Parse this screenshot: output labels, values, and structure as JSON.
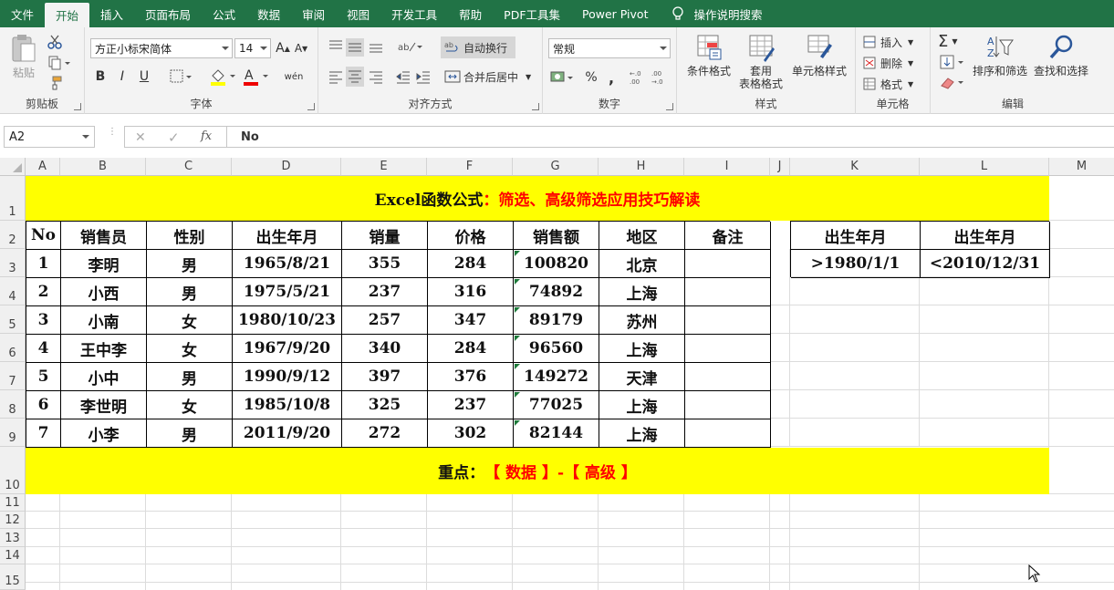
{
  "tabs": [
    "文件",
    "开始",
    "插入",
    "页面布局",
    "公式",
    "数据",
    "审阅",
    "视图",
    "开发工具",
    "帮助",
    "PDF工具集",
    "Power Pivot"
  ],
  "active_tab": "开始",
  "tell_me": "操作说明搜索",
  "ribbon": {
    "clipboard": {
      "label": "剪贴板",
      "paste": "粘贴"
    },
    "font": {
      "label": "字体",
      "name": "方正小标宋简体",
      "size": "14",
      "bold": "B",
      "italic": "I",
      "underline": "U",
      "grow": "A",
      "shrink": "A",
      "wen": "wén"
    },
    "align": {
      "label": "对齐方式",
      "wrap": "自动换行",
      "merge": "合并后居中"
    },
    "number": {
      "label": "数字",
      "format": "常规",
      "percent": "%",
      "comma": ","
    },
    "styles": {
      "label": "样式",
      "cond": "条件格式",
      "table_1": "套用",
      "table_2": "表格格式",
      "cell": "单元格样式"
    },
    "cells": {
      "label": "单元格",
      "insert": "插入",
      "delete": "删除",
      "format": "格式"
    },
    "edit": {
      "label": "编辑",
      "sum": "Σ",
      "sort": "排序和筛选",
      "find": "查找和选择"
    }
  },
  "formula_bar": {
    "name_box": "A2",
    "fx": "fx",
    "value": "No"
  },
  "columns": [
    "A",
    "B",
    "C",
    "D",
    "E",
    "F",
    "G",
    "H",
    "I",
    "J",
    "K",
    "L",
    "M"
  ],
  "rows": [
    "1",
    "2",
    "3",
    "4",
    "5",
    "6",
    "7",
    "8",
    "9",
    "10",
    "11",
    "12",
    "13",
    "14",
    "15"
  ],
  "sheet": {
    "title_black": "Excel函数公式",
    "title_red": "：筛选、高级筛选应用技巧解读",
    "headers": [
      "No",
      "销售员",
      "性别",
      "出生年月",
      "销量",
      "价格",
      "销售额",
      "地区",
      "备注"
    ],
    "data": [
      [
        "1",
        "李明",
        "男",
        "1965/8/21",
        "355",
        "284",
        "100820",
        "北京",
        ""
      ],
      [
        "2",
        "小西",
        "男",
        "1975/5/21",
        "237",
        "316",
        "74892",
        "上海",
        ""
      ],
      [
        "3",
        "小南",
        "女",
        "1980/10/23",
        "257",
        "347",
        "89179",
        "苏州",
        ""
      ],
      [
        "4",
        "王中李",
        "女",
        "1967/9/20",
        "340",
        "284",
        "96560",
        "上海",
        ""
      ],
      [
        "5",
        "小中",
        "男",
        "1990/9/12",
        "397",
        "376",
        "149272",
        "天津",
        ""
      ],
      [
        "6",
        "李世明",
        "女",
        "1985/10/8",
        "325",
        "237",
        "77025",
        "上海",
        ""
      ],
      [
        "7",
        "小李",
        "男",
        "2011/9/20",
        "272",
        "302",
        "82144",
        "上海",
        ""
      ]
    ],
    "criteria_headers": [
      "出生年月",
      "出生年月"
    ],
    "criteria_values": [
      ">1980/1/1",
      "<2010/12/31"
    ],
    "note_black": "重点：",
    "note_red": "【 数据 】-【 高级 】"
  },
  "colors": {
    "excel_green": "#217346",
    "highlight": "#ffff00",
    "red_text": "#ff0000"
  }
}
